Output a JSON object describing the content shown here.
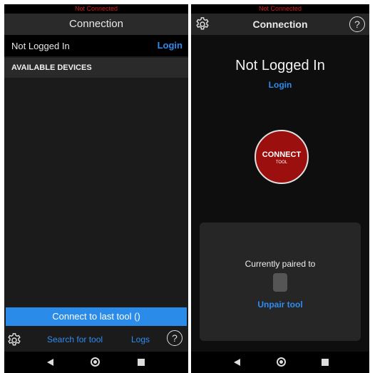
{
  "left": {
    "status": "Not Connected",
    "title": "Connection",
    "login_status": "Not Logged In",
    "login_link": "Login",
    "devices_header": "AVAILABLE DEVICES",
    "connect_last_button": "Connect to last tool ()",
    "search_link": "Search for tool",
    "logs_link": "Logs",
    "help_label": "?"
  },
  "right": {
    "status": "Not Connected",
    "title": "Connection",
    "help_label": "?",
    "login_status": "Not Logged In",
    "login_link": "Login",
    "connect_button": {
      "label": "CONNECT",
      "sublabel": "TOOL"
    },
    "paired_label": "Currently paired to",
    "unpair_link": "Unpair tool"
  },
  "colors": {
    "accent_blue": "#2f8cf0",
    "status_red": "#d21a1a",
    "connect_red": "#9c0f0f",
    "button_blue": "#2a8be8"
  }
}
